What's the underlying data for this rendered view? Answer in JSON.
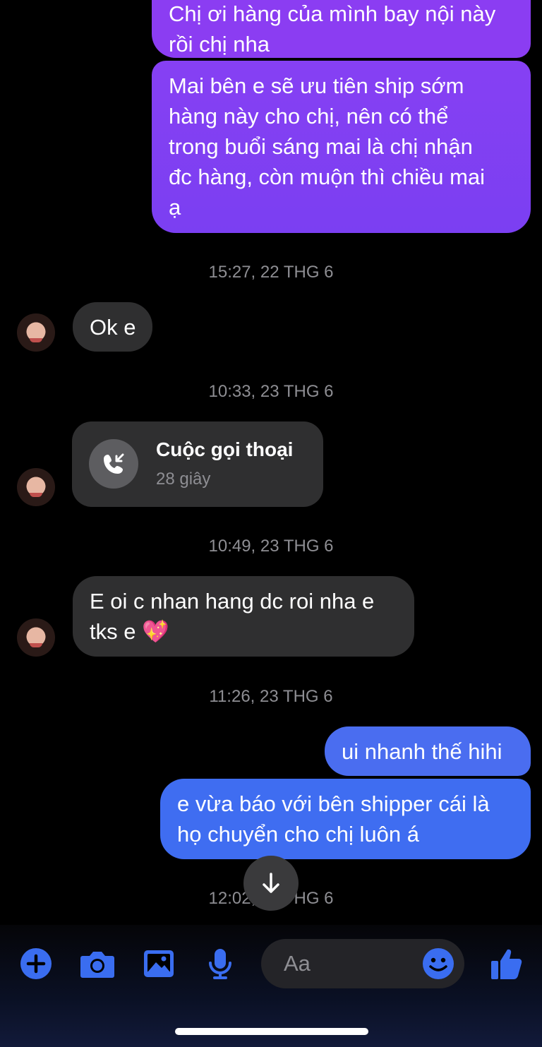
{
  "messages": {
    "m1": {
      "line1": "Chị ơi hàng của mình bay nội này",
      "line2": "rồi chị nha"
    },
    "m2": {
      "lines": [
        "Mai bên e sẽ ưu tiên ship sớm",
        "hàng này cho chị, nên có thể",
        "trong buổi sáng mai là chị nhận",
        "đc hàng, còn muộn thì chiều mai",
        "ạ"
      ]
    },
    "ts1": "15:27, 22 THG 6",
    "m3": "Ok e",
    "ts2": "10:33, 23 THG 6",
    "call": {
      "title": "Cuộc gọi thoại",
      "duration": "28 giây"
    },
    "ts3": "10:49, 23 THG 6",
    "m4": {
      "line1": "E oi c nhan hang dc roi nha e",
      "line2": "tks e 💖"
    },
    "ts4": "11:26, 23 THG 6",
    "m5": "ui nhanh thế hihi",
    "m6": {
      "line1": "e vừa báo với bên shipper cái là",
      "line2": "họ chuyển cho chị luôn á"
    },
    "ts5": "12:02, 23 THG 6"
  },
  "composer": {
    "placeholder": "Aa"
  },
  "icons": {
    "add": "plus-circle-icon",
    "camera": "camera-icon",
    "gallery": "image-icon",
    "mic": "microphone-icon",
    "emoji": "smiley-icon",
    "like": "thumbs-up-icon",
    "scroll": "arrow-down-icon",
    "call": "incoming-call-icon"
  },
  "colors": {
    "accent": "#3a6df0",
    "outgoing_purple": "#7a3cf2",
    "outgoing_blue": "#3d6ef0",
    "incoming": "#2f2f30"
  }
}
